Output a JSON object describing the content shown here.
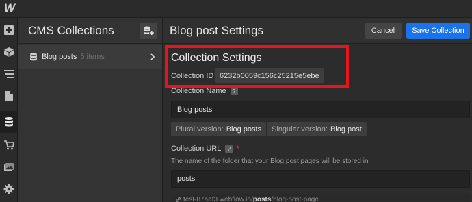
{
  "app": {
    "logo": "W"
  },
  "rail": {
    "icons": [
      "add-icon",
      "box-icon",
      "navigator-icon",
      "pages-icon",
      "cms-icon",
      "ecommerce-icon",
      "assets-icon",
      "settings-icon"
    ],
    "active": "cms-icon"
  },
  "collections_panel": {
    "title": "CMS Collections",
    "items": [
      {
        "name": "Blog posts",
        "count": "5 items"
      }
    ]
  },
  "settings": {
    "title": "Blog post Settings",
    "cancel_label": "Cancel",
    "save_label": "Save Collection",
    "section_title": "Collection Settings",
    "collection_id_label": "Collection ID",
    "collection_id": "6232b0059c156c25215e5ebe",
    "name_label": "Collection Name",
    "name_help": "?",
    "name_value": "Blog posts",
    "plural_label": "Plural version:",
    "plural_value": "Blog posts",
    "singular_label": "Singular version:",
    "singular_value": "Blog post",
    "url_label": "Collection URL",
    "url_help": "?",
    "url_required": "*",
    "url_hint": "The name of the folder that your Blog post pages will be stored in",
    "url_value": "posts",
    "preview_domain": "test-87aaf3.webflow.io/",
    "preview_slug": "posts",
    "preview_rest": "/blog-post-page"
  },
  "colors": {
    "primary": "#1a73e8",
    "highlight": "#e8131b",
    "required": "#e8434a"
  }
}
